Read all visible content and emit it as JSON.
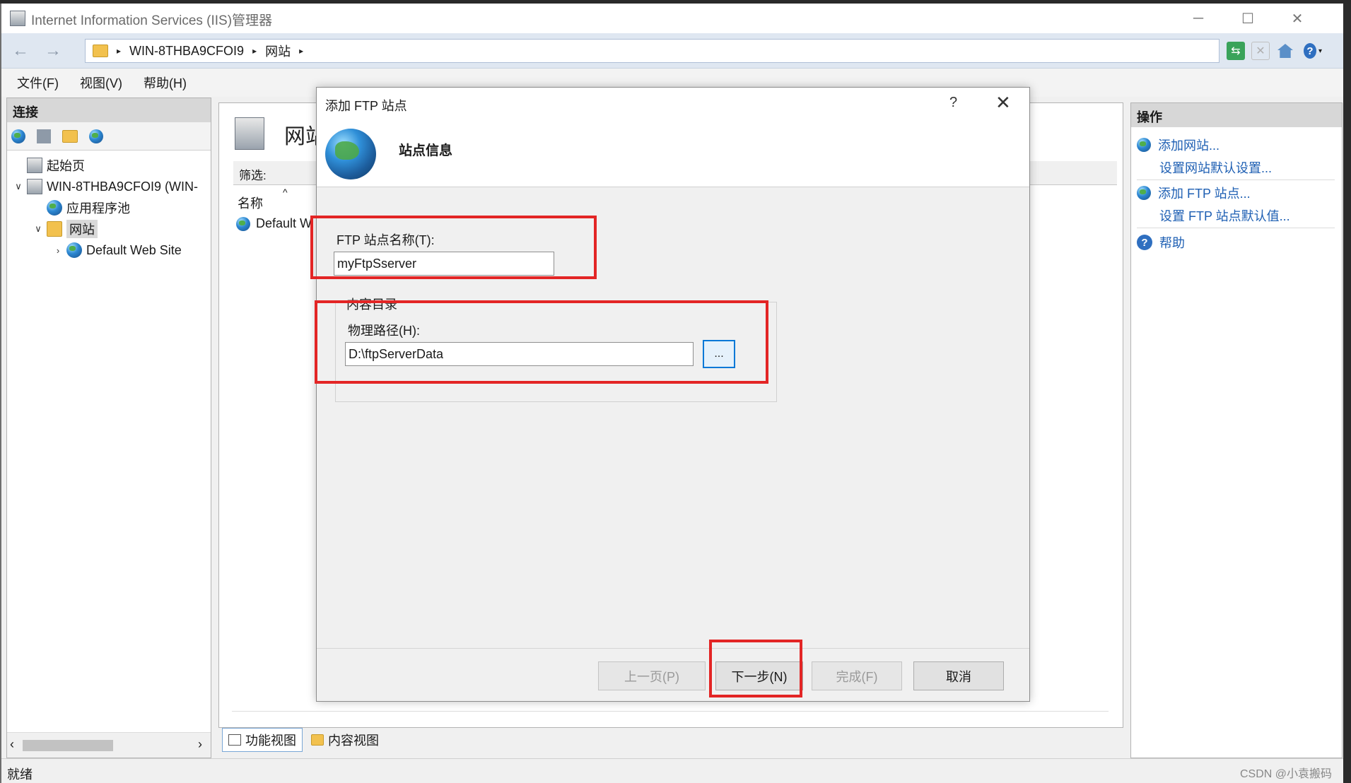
{
  "window": {
    "title": "Internet Information Services (IIS)管理器",
    "minimize": "─",
    "maximize": "☐",
    "close": "✕"
  },
  "address": {
    "back": "←",
    "forward": "→",
    "crumbs": [
      "WIN-8THBA9CFOI9",
      "网站"
    ],
    "sep": "▸"
  },
  "menu": [
    "文件(F)",
    "视图(V)",
    "帮助(H)"
  ],
  "connections": {
    "title": "连接",
    "tree": [
      {
        "label": "起始页",
        "icon": "start-page-icon"
      },
      {
        "label": "WIN-8THBA9CFOI9 (WIN-",
        "icon": "server-icon",
        "chevron": "∨"
      },
      {
        "label": "应用程序池",
        "icon": "app-pool-icon"
      },
      {
        "label": "网站",
        "icon": "sites-folder-icon",
        "chevron": "∨"
      },
      {
        "label": "Default Web Site",
        "icon": "globe-icon",
        "chevron": "›"
      }
    ],
    "scroll_left": "‹",
    "scroll_right": "›"
  },
  "center": {
    "title": "网站",
    "filter_label": "筛选:",
    "col_name": "名称",
    "sort_arrow": "^",
    "row_default": "Default W"
  },
  "view_tabs": {
    "features": "功能视图",
    "content": "内容视图"
  },
  "actions": {
    "title": "操作",
    "items": [
      {
        "label": "添加网站...",
        "icon": "globe-add-icon"
      },
      {
        "label": "设置网站默认设置..."
      },
      {
        "label": "添加 FTP 站点...",
        "icon": "globe-add-icon"
      },
      {
        "label": "设置 FTP 站点默认值..."
      },
      {
        "label": "帮助",
        "icon": "help-icon"
      }
    ]
  },
  "status": {
    "text": "就绪",
    "watermark": "CSDN @小袁搬码"
  },
  "dialog": {
    "title": "添加 FTP 站点",
    "help": "?",
    "close": "✕",
    "heading": "站点信息",
    "site_name_label": "FTP 站点名称(T):",
    "site_name_value": "myFtpSserver",
    "content_dir_label": "内容目录",
    "path_label": "物理路径(H):",
    "path_value": "D:\\ftpServerData",
    "browse": "...",
    "buttons": {
      "prev": "上一页(P)",
      "next": "下一步(N)",
      "finish": "完成(F)",
      "cancel": "取消"
    }
  },
  "colors": {
    "highlight": "#e32525",
    "link": "#1e5fb3",
    "focus": "#0078d7"
  }
}
